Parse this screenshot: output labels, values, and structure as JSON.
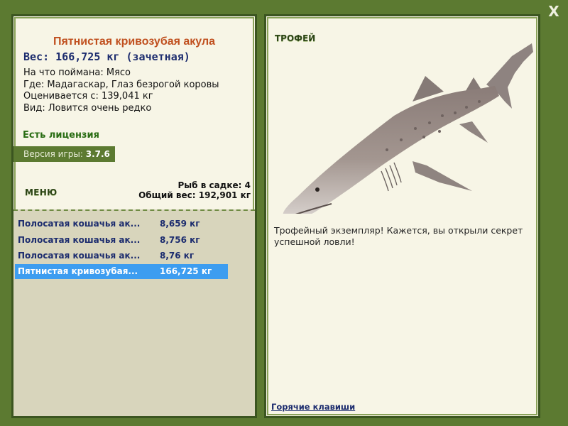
{
  "close_label": "X",
  "fish": {
    "title": "Пятнистая кривозубая акула",
    "weight": "Вес: 166,725 кг (зачетная)",
    "info": [
      "На что поймана: Мясо",
      "Где: Мадагаскар, Глаз безрогой коровы",
      "Оценивается с: 139,041 кг",
      "Вид: Ловится очень редко"
    ]
  },
  "license": "Есть лицензия",
  "version": {
    "label": "Версия игры: ",
    "value": "3.7.6"
  },
  "menu_label": "МЕНЮ",
  "stats": {
    "fish_count": "Рыб в садке: 4",
    "total_weight": "Общий вес: 192,901 кг"
  },
  "catch_list": [
    {
      "name": "Полосатая кошачья ак...",
      "weight": "8,659 кг"
    },
    {
      "name": "Полосатая кошачья ак...",
      "weight": "8,756 кг"
    },
    {
      "name": "Полосатая кошачья ак...",
      "weight": "8,76 кг"
    },
    {
      "name": "Пятнистая кривозубая...",
      "weight": "166,725 кг"
    }
  ],
  "trophy": {
    "label": "ТРОФЕЙ",
    "text": "Трофейный экземпляр! Кажется, вы открыли секрет успешной ловли!"
  },
  "hotkeys_link": "Горячие клавиши",
  "colors": {
    "frame": "#5c7a31",
    "panel": "#f7f5e6",
    "title": "#c0501f",
    "navy": "#1c2c6e",
    "license": "#2a6d14",
    "selected": "#3d9df0"
  }
}
